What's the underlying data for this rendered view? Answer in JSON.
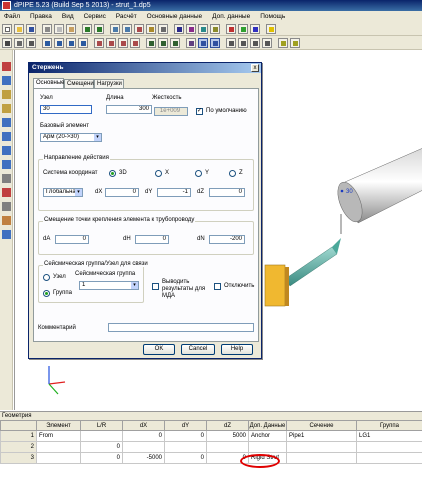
{
  "window": {
    "title": "dPIPE 5.23 (Build Sep 5 2013) - strut_1.dp5"
  },
  "menu": [
    "Файл",
    "Правка",
    "Вид",
    "Сервис",
    "Расчёт",
    "Основные данные",
    "Доп. данные",
    "Помощь"
  ],
  "viewport": {
    "node_label": "30"
  },
  "dialog": {
    "title": "Стержень",
    "close_glyph": "x",
    "tabs": [
      "Основные",
      "Смещения",
      "Нагрузки"
    ],
    "node_label": "Узел",
    "node_value": "30",
    "length_label": "Длина",
    "length_value": "300",
    "stiffness_label": "Жесткость",
    "stiffness_value": "1e+009",
    "default_label": "По умолчанию",
    "default_checked": true,
    "base_element_label": "Базовый элемент",
    "base_element_value": "Арм (20->30)",
    "direction_group": "Направление действия",
    "coord_system_label": "Система координат",
    "coord_options": [
      "3D",
      "X",
      "Y",
      "Z"
    ],
    "coord_selected": "3D",
    "coord_system_value": "Глобальная",
    "dx_label": "dX",
    "dx_value": "0",
    "dy_label": "dY",
    "dy_value": "-1",
    "dz_label": "dZ",
    "dz_value": "0",
    "offset_group": "Смещение точки крепления элемента к трубопроводу",
    "da_label": "dA",
    "da_value": "0",
    "dh_label": "dH",
    "dh_value": "0",
    "dn_label": "dN",
    "dn_value": "-200",
    "seismic_group": "Сейсмическая группа/Узел для связи",
    "seismic_node_label": "Узел",
    "seismic_group_label": "Группа",
    "seismic_selected": "Группа",
    "seismic_sub_label": "Сейсмическая группа",
    "seismic_sub_value": "1",
    "output_label": "Выводить результаты для МДА",
    "disable_label": "Отключить",
    "comment_label": "Комментарий",
    "comment_value": "",
    "ok": "OK",
    "cancel": "Cancel",
    "help": "Help"
  },
  "grid": {
    "title": "Геометрия",
    "columns": [
      "",
      "Элемент",
      "L/R",
      "dX",
      "dY",
      "dZ",
      "Доп. Данные",
      "Сечение",
      "Группа"
    ],
    "rows": [
      [
        "1",
        "From",
        "",
        "0",
        "0",
        "5000",
        "Anchor",
        "Pipe1",
        "LG1"
      ],
      [
        "2",
        "",
        "0",
        "",
        "",
        "",
        "",
        "",
        ""
      ],
      [
        "3",
        "",
        "0",
        "-5000",
        "0",
        "0",
        "Rigid Strut",
        "",
        ""
      ]
    ]
  },
  "colors": {
    "accent": "#0a246a",
    "highlight": "#e00000",
    "face": "#ece9d8"
  }
}
